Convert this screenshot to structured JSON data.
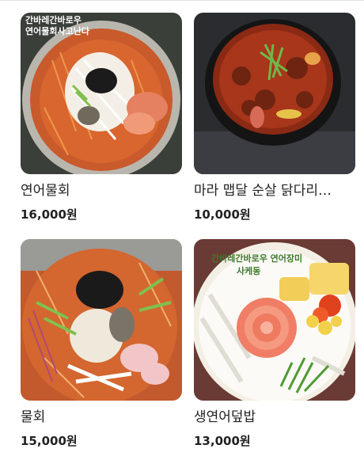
{
  "menu": {
    "items": [
      {
        "name": "연어물회",
        "price": "16,000원",
        "image": "salmon-mulhoe-bowl",
        "watermark": [
          "간바레간바로우",
          "연어물회사고난다"
        ]
      },
      {
        "name": "마라 맵달 순살 닭다리…",
        "price": "10,000원",
        "image": "mala-chicken-stew",
        "watermark": []
      },
      {
        "name": "물회",
        "price": "15,000원",
        "image": "mulhoe-bowl",
        "watermark": []
      },
      {
        "name": "생연어덮밥",
        "price": "13,000원",
        "image": "salmon-rice-bowl",
        "watermark": [
          "간바레간바로우 연어장미",
          "사케동"
        ]
      }
    ]
  }
}
